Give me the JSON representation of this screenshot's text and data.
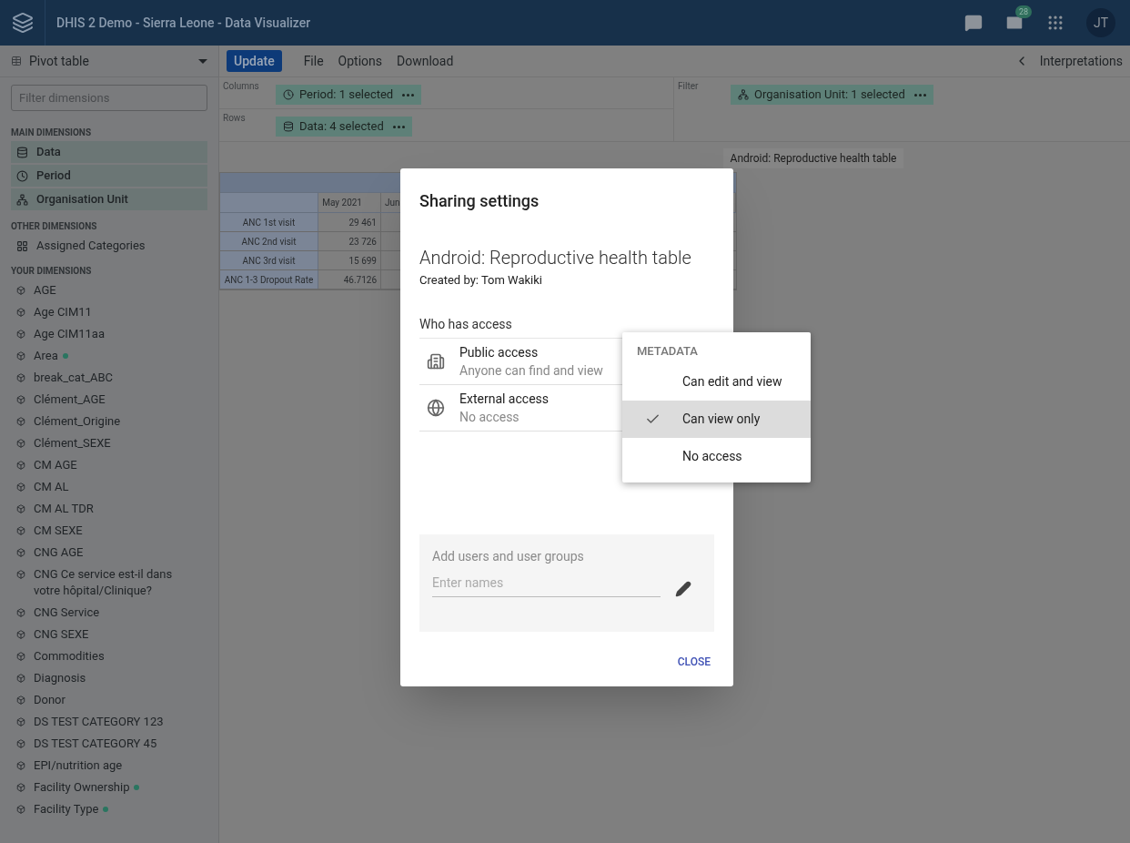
{
  "header": {
    "title": "DHIS 2 Demo - Sierra Leone - Data Visualizer",
    "mail_badge": "28",
    "avatar": "JT"
  },
  "sidebar": {
    "vis_type": "Pivot table",
    "filter_placeholder": "Filter dimensions",
    "sections": [
      {
        "heading": "MAIN DIMENSIONS",
        "items": [
          {
            "label": "Data",
            "kind": "data",
            "selected": true,
            "dot": false
          },
          {
            "label": "Period",
            "kind": "period",
            "selected": true,
            "dot": false
          },
          {
            "label": "Organisation Unit",
            "kind": "orgunit",
            "selected": true,
            "dot": false
          }
        ]
      },
      {
        "heading": "OTHER DIMENSIONS",
        "items": [
          {
            "label": "Assigned Categories",
            "kind": "category",
            "selected": false,
            "dot": false
          }
        ]
      },
      {
        "heading": "YOUR DIMENSIONS",
        "items": [
          {
            "label": "AGE",
            "kind": "group",
            "selected": false,
            "dot": false
          },
          {
            "label": "Age CIM11",
            "kind": "group",
            "selected": false,
            "dot": false
          },
          {
            "label": "Age CIM11aa",
            "kind": "group",
            "selected": false,
            "dot": false
          },
          {
            "label": "Area",
            "kind": "group",
            "selected": false,
            "dot": true
          },
          {
            "label": "break_cat_ABC",
            "kind": "group",
            "selected": false,
            "dot": false
          },
          {
            "label": "Clément_AGE",
            "kind": "group",
            "selected": false,
            "dot": false
          },
          {
            "label": "Clément_Origine",
            "kind": "group",
            "selected": false,
            "dot": false
          },
          {
            "label": "Clément_SEXE",
            "kind": "group",
            "selected": false,
            "dot": false
          },
          {
            "label": "CM AGE",
            "kind": "group",
            "selected": false,
            "dot": false
          },
          {
            "label": "CM AL",
            "kind": "group",
            "selected": false,
            "dot": false
          },
          {
            "label": "CM AL TDR",
            "kind": "group",
            "selected": false,
            "dot": false
          },
          {
            "label": "CM SEXE",
            "kind": "group",
            "selected": false,
            "dot": false
          },
          {
            "label": "CNG AGE",
            "kind": "group",
            "selected": false,
            "dot": false
          },
          {
            "label": "CNG Ce service est-il dans votre hôpital/Clinique?",
            "kind": "group",
            "selected": false,
            "dot": false
          },
          {
            "label": "CNG Service",
            "kind": "group",
            "selected": false,
            "dot": false
          },
          {
            "label": "CNG SEXE",
            "kind": "group",
            "selected": false,
            "dot": false
          },
          {
            "label": "Commodities",
            "kind": "group",
            "selected": false,
            "dot": false
          },
          {
            "label": "Diagnosis",
            "kind": "group",
            "selected": false,
            "dot": false
          },
          {
            "label": "Donor",
            "kind": "group",
            "selected": false,
            "dot": false
          },
          {
            "label": "DS TEST CATEGORY 123",
            "kind": "group",
            "selected": false,
            "dot": false
          },
          {
            "label": "DS TEST CATEGORY 45",
            "kind": "group",
            "selected": false,
            "dot": false
          },
          {
            "label": "EPI/nutrition age",
            "kind": "group",
            "selected": false,
            "dot": false
          },
          {
            "label": "Facility Ownership",
            "kind": "group",
            "selected": false,
            "dot": true
          },
          {
            "label": "Facility Type",
            "kind": "group",
            "selected": false,
            "dot": true
          }
        ]
      }
    ]
  },
  "toolbar": {
    "update": "Update",
    "menus": [
      "File",
      "Options",
      "Download"
    ],
    "interpretations": "Interpretations"
  },
  "layout": {
    "columns": {
      "label": "Columns",
      "chips": [
        {
          "label": "Period: 1 selected",
          "kind": "period"
        }
      ]
    },
    "rows": {
      "label": "Rows",
      "chips": [
        {
          "label": "Data: 4 selected",
          "kind": "data"
        }
      ]
    },
    "filter": {
      "label": "Filter",
      "chips": [
        {
          "label": "Organisation Unit: 1 selected",
          "kind": "orgunit"
        }
      ]
    }
  },
  "visualization_title": "Android: Reproductive health table",
  "table": {
    "columns": [
      "May 2021",
      "Jun"
    ],
    "rows": [
      {
        "label": "ANC 1st visit",
        "value": "29 461"
      },
      {
        "label": "ANC 2nd visit",
        "value": "23 726"
      },
      {
        "label": "ANC 3rd visit",
        "value": "15 699"
      },
      {
        "label": "ANC 1-3 Dropout Rate",
        "value": "46.7126"
      }
    ]
  },
  "dialog": {
    "title": "Sharing settings",
    "object_name": "Android: Reproductive health table",
    "created_by": "Created by: Tom Wakiki",
    "access_heading": "Who has access",
    "access": [
      {
        "name": "Public access",
        "description": "Anyone can find and view",
        "kind": "public"
      },
      {
        "name": "External access",
        "description": "No access",
        "kind": "external"
      }
    ],
    "add_users": {
      "heading": "Add users and user groups",
      "placeholder": "Enter names"
    },
    "close": "CLOSE"
  },
  "menu": {
    "heading": "METADATA",
    "options": [
      {
        "label": "Can edit and view",
        "selected": false
      },
      {
        "label": "Can view only",
        "selected": true
      },
      {
        "label": "No access",
        "selected": false
      }
    ]
  }
}
